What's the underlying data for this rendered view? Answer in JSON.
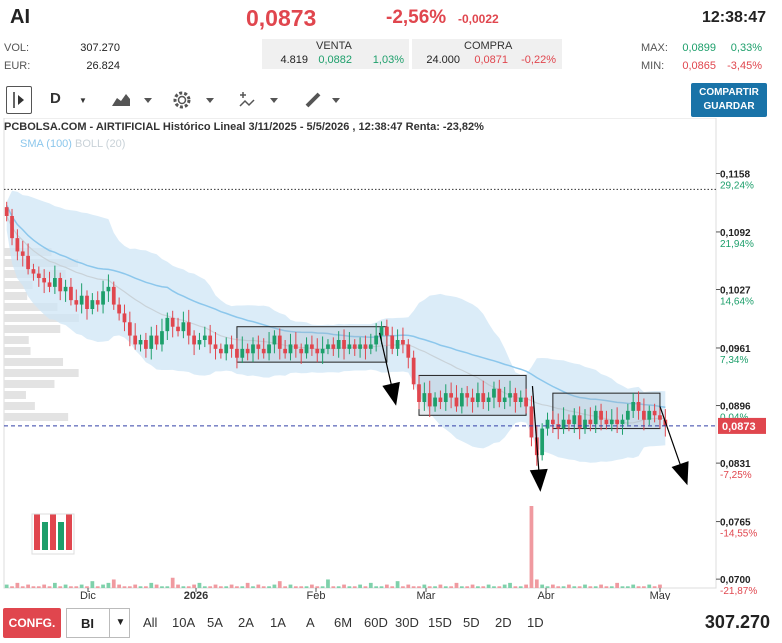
{
  "header": {
    "ticker": "AI",
    "price": "0,0873",
    "change_pct": "-2,56%",
    "change_abs": "-0,0022",
    "time": "12:38:47",
    "vol_label": "VOL:",
    "vol_value": "307.270",
    "eur_label": "EUR:",
    "eur_value": "26.824",
    "venta_label": "VENTA",
    "venta_qty": "4.819",
    "venta_price": "0,0882",
    "venta_pct": "1,03%",
    "compra_label": "COMPRA",
    "compra_qty": "24.000",
    "compra_price": "0,0871",
    "compra_pct": "-0,22%",
    "max_label": "MAX:",
    "max_price": "0,0899",
    "max_pct": "0,33%",
    "min_label": "MIN:",
    "min_price": "0,0865",
    "min_pct": "-3,45%"
  },
  "toolbar": {
    "period_label": "D",
    "share_line1": "COMPARTIR",
    "share_line2": "GUARDAR"
  },
  "footer": {
    "config_label": "CONFG.",
    "bi_label": "BI",
    "ranges": [
      "All",
      "10A",
      "5A",
      "2A",
      "1A",
      "A",
      "6M",
      "60D",
      "30D",
      "15D",
      "5D",
      "2D",
      "1D"
    ],
    "volume": "307.270"
  },
  "colors": {
    "up": "#1d9f6b",
    "down": "#e0464e",
    "band": "#cfe6f5",
    "sma": "#8cc7ec",
    "accent": "#1973a8"
  },
  "chart_data": {
    "type": "candlestick",
    "title": "PCBOLSA.COM - AIRTIFICIAL Histórico Lineal 3/11/2025 - 5/5/2026 , 12:38:47 Renta: -23,82%",
    "legend": [
      {
        "name": "SMA (100)"
      },
      {
        "name": "BOLL (20)"
      }
    ],
    "x_ticks": [
      "Dic",
      "2026",
      "Feb",
      "Mar",
      "Abr",
      "May"
    ],
    "y_ticks": [
      {
        "price": "0,1158",
        "pct": "29,24%"
      },
      {
        "price": "0,1092",
        "pct": "21,94%"
      },
      {
        "price": "0,1027",
        "pct": "14,64%"
      },
      {
        "price": "0,0961",
        "pct": "7,34%"
      },
      {
        "price": "0,0896",
        "pct": "0,04%"
      },
      {
        "price": "0,0831",
        "pct": "-7,25%"
      },
      {
        "price": "0,0765",
        "pct": "-14,55%"
      },
      {
        "price": "0,0700",
        "pct": "-21,87%"
      }
    ],
    "ylim": [
      0.069,
      0.118
    ],
    "last_price_label": "0,0873",
    "last_price": 0.0873,
    "reference_price": 0.114,
    "closes": [
      0.111,
      0.1085,
      0.107,
      0.1065,
      0.105,
      0.1045,
      0.104,
      0.1035,
      0.103,
      0.104,
      0.1025,
      0.103,
      0.1015,
      0.101,
      0.102,
      0.1005,
      0.1015,
      0.101,
      0.1025,
      0.103,
      0.101,
      0.1,
      0.099,
      0.0975,
      0.0965,
      0.097,
      0.096,
      0.0975,
      0.0965,
      0.098,
      0.0995,
      0.0985,
      0.098,
      0.099,
      0.0975,
      0.0965,
      0.097,
      0.0975,
      0.0965,
      0.096,
      0.0955,
      0.0965,
      0.096,
      0.095,
      0.096,
      0.0955,
      0.0965,
      0.096,
      0.0955,
      0.0965,
      0.0975,
      0.096,
      0.0955,
      0.0965,
      0.096,
      0.0955,
      0.0965,
      0.096,
      0.0955,
      0.096,
      0.0965,
      0.096,
      0.097,
      0.096,
      0.0965,
      0.096,
      0.0965,
      0.096,
      0.0965,
      0.0975,
      0.0985,
      0.0975,
      0.096,
      0.097,
      0.0965,
      0.095,
      0.092,
      0.09,
      0.091,
      0.0895,
      0.0905,
      0.09,
      0.091,
      0.0905,
      0.0895,
      0.091,
      0.0905,
      0.09,
      0.091,
      0.09,
      0.0905,
      0.0915,
      0.09,
      0.0905,
      0.091,
      0.09,
      0.0905,
      0.0895,
      0.086,
      0.084,
      0.087,
      0.088,
      0.0875,
      0.087,
      0.088,
      0.0875,
      0.0885,
      0.087,
      0.088,
      0.0875,
      0.089,
      0.088,
      0.0875,
      0.088,
      0.0875,
      0.088,
      0.089,
      0.09,
      0.089,
      0.088,
      0.089,
      0.0885,
      0.088,
      0.0873
    ],
    "volumes": [
      2,
      1,
      3,
      1,
      2,
      1,
      1,
      2,
      1,
      3,
      1,
      2,
      1,
      1,
      2,
      1,
      4,
      1,
      2,
      3,
      5,
      2,
      1,
      1,
      2,
      1,
      1,
      3,
      2,
      1,
      1,
      6,
      2,
      1,
      1,
      2,
      3,
      1,
      1,
      2,
      1,
      1,
      2,
      1,
      1,
      3,
      1,
      2,
      1,
      1,
      2,
      4,
      1,
      2,
      1,
      1,
      1,
      2,
      1,
      1,
      5,
      1,
      1,
      2,
      1,
      1,
      2,
      1,
      3,
      1,
      1,
      2,
      1,
      4,
      1,
      2,
      1,
      1,
      2,
      1,
      1,
      2,
      1,
      1,
      3,
      1,
      1,
      2,
      1,
      1,
      2,
      1,
      1,
      2,
      3,
      1,
      1,
      2,
      48,
      5,
      2,
      1,
      2,
      1,
      1,
      2,
      1,
      1,
      2,
      1,
      1,
      2,
      1,
      1,
      3,
      1,
      1,
      2,
      1,
      1,
      2,
      1,
      2
    ],
    "annotation_boxes": [
      {
        "start": 0.0975,
        "end": 0.0955,
        "from_index": 44,
        "to_index": 70
      },
      {
        "start": 0.092,
        "end": 0.0895,
        "from_index": 78,
        "to_index": 96
      },
      {
        "start": 0.09,
        "end": 0.088,
        "from_index": 103,
        "to_index": 121
      }
    ]
  }
}
